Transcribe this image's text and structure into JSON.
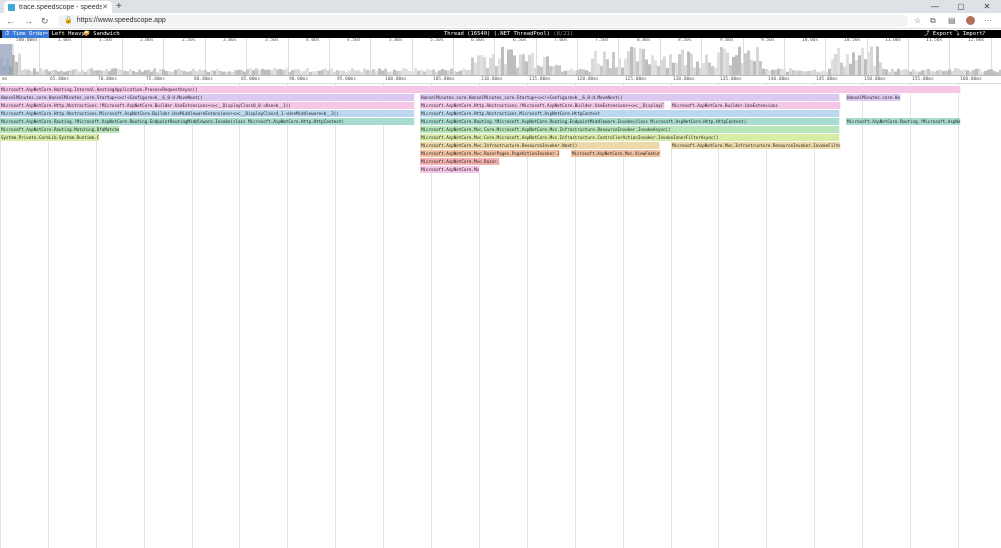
{
  "browser": {
    "tab_title": "trace.speedscope - speedscope",
    "new_tab": "+",
    "url": "https://www.speedscope.app",
    "window_controls": [
      "—",
      "▢",
      "✕"
    ]
  },
  "toolbar": {
    "tabs": [
      {
        "label": "⏱ Time Order",
        "active": true
      },
      {
        "label": "⬅ Left Heavy",
        "active": false
      },
      {
        "label": "🥪 Sandwich",
        "active": false
      }
    ],
    "thread_name": "Thread (16540) (.NET ThreadPool)",
    "thread_index": "(8/21)",
    "actions": [
      "⤴ Export",
      "⤵ Import",
      "? Help"
    ]
  },
  "minimap": {
    "ticks": [
      "500.00ms",
      "1.00s",
      "1.50s",
      "2.00s",
      "2.50s",
      "3.00s",
      "3.50s",
      "4.00s",
      "4.50s",
      "5.00s",
      "5.50s",
      "6.00s",
      "6.50s",
      "7.00s",
      "7.50s",
      "8.00s",
      "8.50s",
      "9.00s",
      "9.50s",
      "10.00s",
      "10.50s",
      "11.00s",
      "11.50s",
      "12.00s"
    ]
  },
  "ruler": {
    "ticks": [
      "ms",
      "65.00ms",
      "70.00ms",
      "75.00ms",
      "80.00ms",
      "85.00ms",
      "90.00ms",
      "95.00ms",
      "100.00ms",
      "105.00ms",
      "110.00ms",
      "115.00ms",
      "120.00ms",
      "125.00ms",
      "130.00ms",
      "135.00ms",
      "140.00ms",
      "145.00ms",
      "150.00ms",
      "155.00ms",
      "160.00ms"
    ]
  },
  "colors": {
    "pink": "#f5c6e6",
    "purple": "#dcc8f0",
    "blue": "#bcd8f0",
    "teal": "#a8dcd0",
    "green": "#b8e6b8",
    "lime": "#d8eca8",
    "tan": "#ecd8a8",
    "orange": "#f0c0a0",
    "red": "#f4b0b0"
  },
  "flamegraph": {
    "frames": [
      {
        "name": "Microsoft.AspNetCore.Hosting.Internal.HostingApplication.ProcessRequestAsync()",
        "depth": 0,
        "start": 0,
        "end": 0.96,
        "c": "pink"
      },
      {
        "name": "HanselMinutes.core.HanselMinutes_core.Startup+<>c!<Configure>b__6_0-d.MoveNext()",
        "depth": 1,
        "start": 0,
        "end": 0.415,
        "c": "purple"
      },
      {
        "name": "HanselMinutes.core.HanselMinutes_core.Startup+<>c!<Configure>b__6_0-d.MoveNext()",
        "depth": 1,
        "start": 0.42,
        "end": 0.84,
        "c": "purple"
      },
      {
        "name": "HanselMinutes.core.HanselMinutes.Startup+<>c!<Configure>b__6_0-d.MoveNext()",
        "depth": 1,
        "start": 0.845,
        "end": 0.9,
        "c": "purple"
      },
      {
        "name": "Microsoft.AspNetCore.Http.Abstractions.!Microsoft.AspNetCore.Builder.UseExtensions+<>c__DisplayClass0_0.<Use>b__1()",
        "depth": 2,
        "start": 0,
        "end": 0.415,
        "c": "pink"
      },
      {
        "name": "Microsoft.AspNetCore.Http.Abstractions.!Microsoft.AspNetCore.Builder.UseExtensions+<>c__DisplayClass0_0.<Use>b__1()",
        "depth": 2,
        "start": 0.42,
        "end": 0.665,
        "c": "pink"
      },
      {
        "name": "Microsoft.AspNetCore.Builder.UseExtensions",
        "depth": 2,
        "start": 0.67,
        "end": 0.84,
        "c": "pink"
      },
      {
        "name": "Microsoft.AspNetCore.Http.Abstractions.Microsoft.AspNetCore.Builder.UseMiddlewareExtensions+<>c__DisplayClass4_1.<UseMiddleware>b__2()",
        "depth": 3,
        "start": 0,
        "end": 0.415,
        "c": "blue"
      },
      {
        "name": "Microsoft.AspNetCore.Http.Abstractions.Microsoft.AspNetCore.HttpContext",
        "depth": 3,
        "start": 0.42,
        "end": 0.84,
        "c": "blue"
      },
      {
        "name": "Microsoft.AspNetCore.Routing.!Microsoft.AspNetCore.Routing.EndpointRoutingMiddleware.Invoke(class Microsoft.AspNetCore.Http.HttpContext)",
        "depth": 4,
        "start": 0,
        "end": 0.415,
        "c": "teal"
      },
      {
        "name": "Microsoft.AspNetCore.Routing.!Microsoft.AspNetCore.Routing.EndpointMiddleware.Invoke(class Microsoft.AspNetCore.Http.HttpContext)",
        "depth": 4,
        "start": 0.42,
        "end": 0.84,
        "c": "teal"
      },
      {
        "name": "Microsoft.AspNetCore.Routing.!Microsoft.AspNetCore.Routing.EndpointRoutingMiddleware.Invoke()",
        "depth": 4,
        "start": 0.845,
        "end": 0.96,
        "c": "teal"
      },
      {
        "name": "Microsoft.AspNetCore.Routing.Matching.DfaMatcher.MatchAsync()",
        "depth": 5,
        "start": 0,
        "end": 0.12,
        "c": "green"
      },
      {
        "name": "Microsoft.AspNetCore.Mvc.Core.Microsoft.AspNetCore.Mvc.Infrastructure.ResourceInvoker.InvokeAsync()",
        "depth": 5,
        "start": 0.42,
        "end": 0.84,
        "c": "green"
      },
      {
        "name": "System.Private.CoreLib.System.Runtime.CompilerServices.AsyncMethodBuilderCore.Start()",
        "depth": 6,
        "start": 0,
        "end": 0.1,
        "c": "lime"
      },
      {
        "name": "Microsoft.AspNetCore.Mvc.Core.Microsoft.AspNetCore.Mvc.Infrastructure.ControllerActionInvoker.InvokeInnerFilterAsync()",
        "depth": 6,
        "start": 0.42,
        "end": 0.84,
        "c": "lime"
      },
      {
        "name": "Microsoft.AspNetCore.Mvc.Infrastructure.ResourceInvoker.Next()",
        "depth": 7,
        "start": 0.42,
        "end": 0.66,
        "c": "tan"
      },
      {
        "name": "Microsoft.AspNetCore.Mvc.Infrastructure.ResourceInvoker.InvokeFilterPipelineAsync()",
        "depth": 7,
        "start": 0.67,
        "end": 0.84,
        "c": "tan"
      },
      {
        "name": "Microsoft.AspNetCore.Mvc.RazorPages.PageActionInvoker.InvokeInnerFilterAsync()",
        "depth": 8,
        "start": 0.42,
        "end": 0.56,
        "c": "orange"
      },
      {
        "name": "Microsoft.AspNetCore.Mvc.ViewFeatures.ViewExecutor.ExecuteAsync()",
        "depth": 8,
        "start": 0.57,
        "end": 0.66,
        "c": "orange"
      },
      {
        "name": "Microsoft.AspNetCore.Mvc.Razor.RazorView.RenderAsync()",
        "depth": 9,
        "start": 0.42,
        "end": 0.5,
        "c": "red"
      },
      {
        "name": "Microsoft.AspNetCore.Mvc.Razor.RazorPageBase.ExecuteAsync()",
        "depth": 10,
        "start": 0.42,
        "end": 0.48,
        "c": "pink"
      }
    ]
  }
}
